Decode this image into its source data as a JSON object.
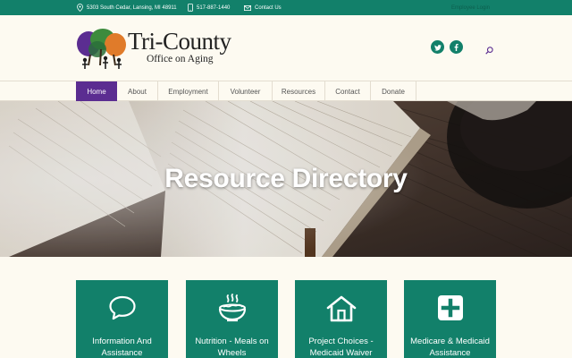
{
  "topbar": {
    "address": "5303 South Cedar, Lansing, MI 48911",
    "phone": "517-887-1440",
    "contact": "Contact Us",
    "login": "Employee Login"
  },
  "logo": {
    "title": "Tri-County",
    "subtitle": "Office on Aging"
  },
  "social": {
    "twitter_icon": "twitter-icon",
    "facebook_icon": "facebook-icon",
    "search_icon": "search-icon"
  },
  "nav": {
    "items": [
      "Home",
      "About",
      "Employment",
      "Volunteer",
      "Resources",
      "Contact",
      "Donate"
    ],
    "active": "Home"
  },
  "hero": {
    "title": "Resource Directory"
  },
  "cards": [
    {
      "label": "Information And Assistance",
      "icon": "speech-bubble-icon"
    },
    {
      "label": "Nutrition - Meals on Wheels",
      "icon": "hot-food-bowl-icon"
    },
    {
      "label": "Project Choices - Medicaid Waiver",
      "icon": "house-icon"
    },
    {
      "label": "Medicare & Medicaid Assistance",
      "icon": "medical-cross-icon"
    }
  ],
  "colors": {
    "brand_green": "#12806a",
    "nav_active": "#5b2d91",
    "background": "#fdfaf1"
  }
}
